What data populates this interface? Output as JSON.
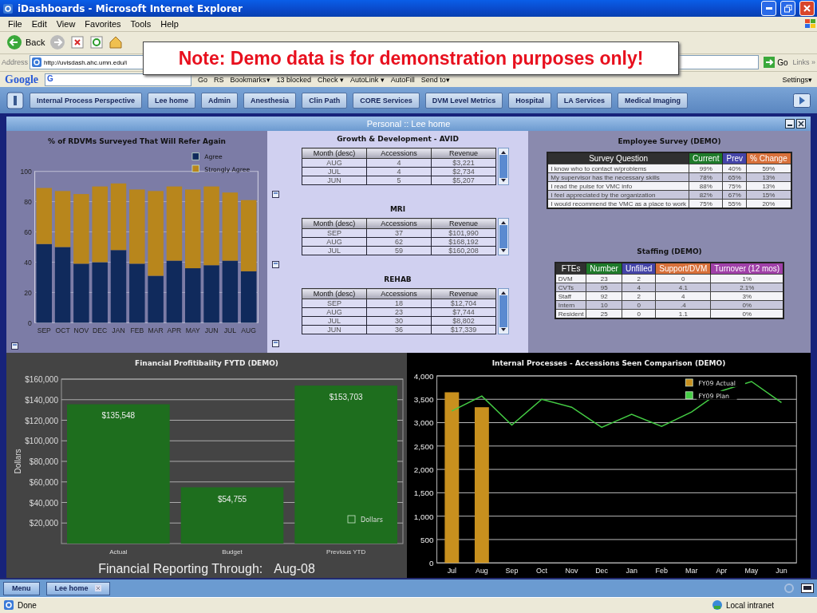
{
  "window": {
    "title": "iDashboards - Microsoft Internet Explorer"
  },
  "menu_bar": [
    "File",
    "Edit",
    "View",
    "Favorites",
    "Tools",
    "Help"
  ],
  "toolbar": {
    "back": "Back"
  },
  "address_bar": {
    "label": "Address",
    "value": "http://uvisdash.ahc.umn.edu/i",
    "go": "Go",
    "links": "Links »"
  },
  "google_bar": {
    "logo": "Google",
    "field": "G",
    "items": [
      "Go",
      "RS",
      "Bookmarks▾",
      "13 blocked",
      "Check ▾",
      "AutoLink ▾",
      "AutoFill",
      "Send to▾"
    ],
    "settings": "Settings▾"
  },
  "note": "Note: Demo data is for demonstration purposes only!",
  "tabs": [
    "Internal Process Perspective",
    "Lee home",
    "Admin",
    "Anesthesia",
    "Clin Path",
    "CORE Services",
    "DVM Level Metrics",
    "Hospital",
    "LA Services",
    "Medical Imaging"
  ],
  "dashboard": {
    "title": "Personal :: Lee home"
  },
  "survey_chart": {
    "chart_data": {
      "type": "bar",
      "title": "% of RDVMs Surveyed That Will Refer Again",
      "categories": [
        "SEP",
        "OCT",
        "NOV",
        "DEC",
        "JAN",
        "FEB",
        "MAR",
        "APR",
        "MAY",
        "JUN",
        "JUL",
        "AUG"
      ],
      "stacked": true,
      "grid": true,
      "legend": "upper right",
      "ylim": [
        0,
        100
      ],
      "yticks": [
        0,
        20,
        40,
        60,
        80,
        100
      ],
      "series": [
        {
          "name": "Agree",
          "color": "#102a5c",
          "values": [
            52,
            50,
            39,
            40,
            48,
            39,
            31,
            41,
            36,
            38,
            41,
            34
          ]
        },
        {
          "name": "Strongly Agree",
          "color": "#b8861c",
          "values": [
            37,
            37,
            46,
            50,
            44,
            49,
            56,
            49,
            52,
            52,
            45,
            47
          ]
        }
      ]
    }
  },
  "tables": [
    {
      "title": "Growth & Development - AVID",
      "columns": [
        "Month (desc)",
        "Accessions",
        "Revenue"
      ],
      "rows": [
        [
          "AUG",
          "4",
          "$3,221"
        ],
        [
          "JUL",
          "4",
          "$2,734"
        ],
        [
          "JUN",
          "5",
          "$5,207"
        ]
      ]
    },
    {
      "title": "MRI",
      "columns": [
        "Month (desc)",
        "Accessions",
        "Revenue"
      ],
      "rows": [
        [
          "SEP",
          "37",
          "$101,990"
        ],
        [
          "AUG",
          "62",
          "$168,192"
        ],
        [
          "JUL",
          "59",
          "$160,208"
        ]
      ]
    },
    {
      "title": "REHAB",
      "columns": [
        "Month (desc)",
        "Accessions",
        "Revenue"
      ],
      "rows": [
        [
          "SEP",
          "18",
          "$12,704"
        ],
        [
          "AUG",
          "23",
          "$7,744"
        ],
        [
          "JUL",
          "30",
          "$8,802"
        ],
        [
          "JUN",
          "36",
          "$17,339"
        ]
      ]
    }
  ],
  "employee_survey": {
    "title": "Employee Survey (DEMO)",
    "columns": [
      {
        "label": "Survey Question",
        "color": "#303030"
      },
      {
        "label": "Current",
        "color": "#1e7a2a"
      },
      {
        "label": "Prev",
        "color": "#4444a8"
      },
      {
        "label": "% Change",
        "color": "#d8703a"
      }
    ],
    "rows": [
      [
        "I know who to contact w/problems",
        "99%",
        "40%",
        "59%"
      ],
      [
        "My supervisor has the necessary skills",
        "78%",
        "65%",
        "13%"
      ],
      [
        "I read the pulse for VMC info",
        "88%",
        "75%",
        "13%"
      ],
      [
        "I feel appreciated by the organization",
        "82%",
        "67%",
        "15%"
      ],
      [
        "I would recommend the VMC as a place to work",
        "75%",
        "55%",
        "20%"
      ]
    ]
  },
  "staffing": {
    "title": "Staffing (DEMO)",
    "columns": [
      {
        "label": "FTEs",
        "color": "#303030"
      },
      {
        "label": "Number",
        "color": "#1e7a2a"
      },
      {
        "label": "Unfilled",
        "color": "#4444a8"
      },
      {
        "label": "Support/DVM",
        "color": "#d8703a"
      },
      {
        "label": "Turnover (12 mos)",
        "color": "#a040a8"
      }
    ],
    "rows": [
      [
        "DVM",
        "23",
        "2",
        "0",
        "1%"
      ],
      [
        "CVTs",
        "95",
        "4",
        "4.1",
        "2.1%"
      ],
      [
        "Staff",
        "92",
        "2",
        "4",
        "3%"
      ],
      [
        "Intern",
        "10",
        "0",
        ".4",
        "0%"
      ],
      [
        "Resident",
        "25",
        "0",
        "1.1",
        "0%"
      ]
    ]
  },
  "financial_chart": {
    "chart_data": {
      "type": "bar",
      "title": "Financial Profitibality FYTD (DEMO)",
      "ylabel": "Dollars",
      "categories": [
        "Actual",
        "Budget",
        "Previous YTD"
      ],
      "grid": true,
      "legend": "lower right",
      "ylim": [
        0,
        160000
      ],
      "yticks": [
        {
          "value": 20000,
          "label": "$20,000"
        },
        {
          "value": 40000,
          "label": "$40,000"
        },
        {
          "value": 60000,
          "label": "$60,000"
        },
        {
          "value": 80000,
          "label": "$80,000"
        },
        {
          "value": 100000,
          "label": "$100,000"
        },
        {
          "value": 120000,
          "label": "$120,000"
        },
        {
          "value": 140000,
          "label": "$140,000"
        },
        {
          "value": 160000,
          "label": "$160,000"
        }
      ],
      "value_labels": [
        "$135,548",
        "$54,755",
        "$153,703"
      ],
      "series": [
        {
          "name": "Dollars",
          "color": "#1e6e1e",
          "values": [
            135548,
            54755,
            153703
          ]
        }
      ]
    },
    "footer": "Financial Reporting Through:",
    "footer_date": "Aug-08"
  },
  "accessions_chart": {
    "chart_data": {
      "type": "bar",
      "title": "Internal Processes - Accessions Seen Comparison (DEMO)",
      "categories": [
        "Jul",
        "Aug",
        "Sep",
        "Oct",
        "Nov",
        "Dec",
        "Jan",
        "Feb",
        "Mar",
        "Apr",
        "May",
        "Jun"
      ],
      "grid": true,
      "legend": "upper right",
      "ylim": [
        0,
        4000
      ],
      "yticks": [
        {
          "value": 0,
          "label": "0"
        },
        {
          "value": 500,
          "label": "500"
        },
        {
          "value": 1000,
          "label": "1,000"
        },
        {
          "value": 1500,
          "label": "1,500"
        },
        {
          "value": 2000,
          "label": "2,000"
        },
        {
          "value": 2500,
          "label": "2,500"
        },
        {
          "value": 3000,
          "label": "3,000"
        },
        {
          "value": 3500,
          "label": "3,500"
        },
        {
          "value": 4000,
          "label": "4,000"
        }
      ],
      "series": [
        {
          "name": "FY09 Actual",
          "type": "bar",
          "color": "#c8901e",
          "values": [
            3650,
            3330,
            null,
            null,
            null,
            null,
            null,
            null,
            null,
            null,
            null,
            null
          ]
        },
        {
          "name": "FY09 Plan",
          "type": "line",
          "color": "#44cc44",
          "values": [
            3250,
            3570,
            2950,
            3500,
            3330,
            2900,
            3180,
            2920,
            3230,
            3680,
            3880,
            3430
          ]
        }
      ]
    }
  },
  "bottom_tabs": [
    "Menu",
    "Lee home"
  ],
  "status_bar": {
    "left": "Done",
    "zone": "Local intranet"
  }
}
